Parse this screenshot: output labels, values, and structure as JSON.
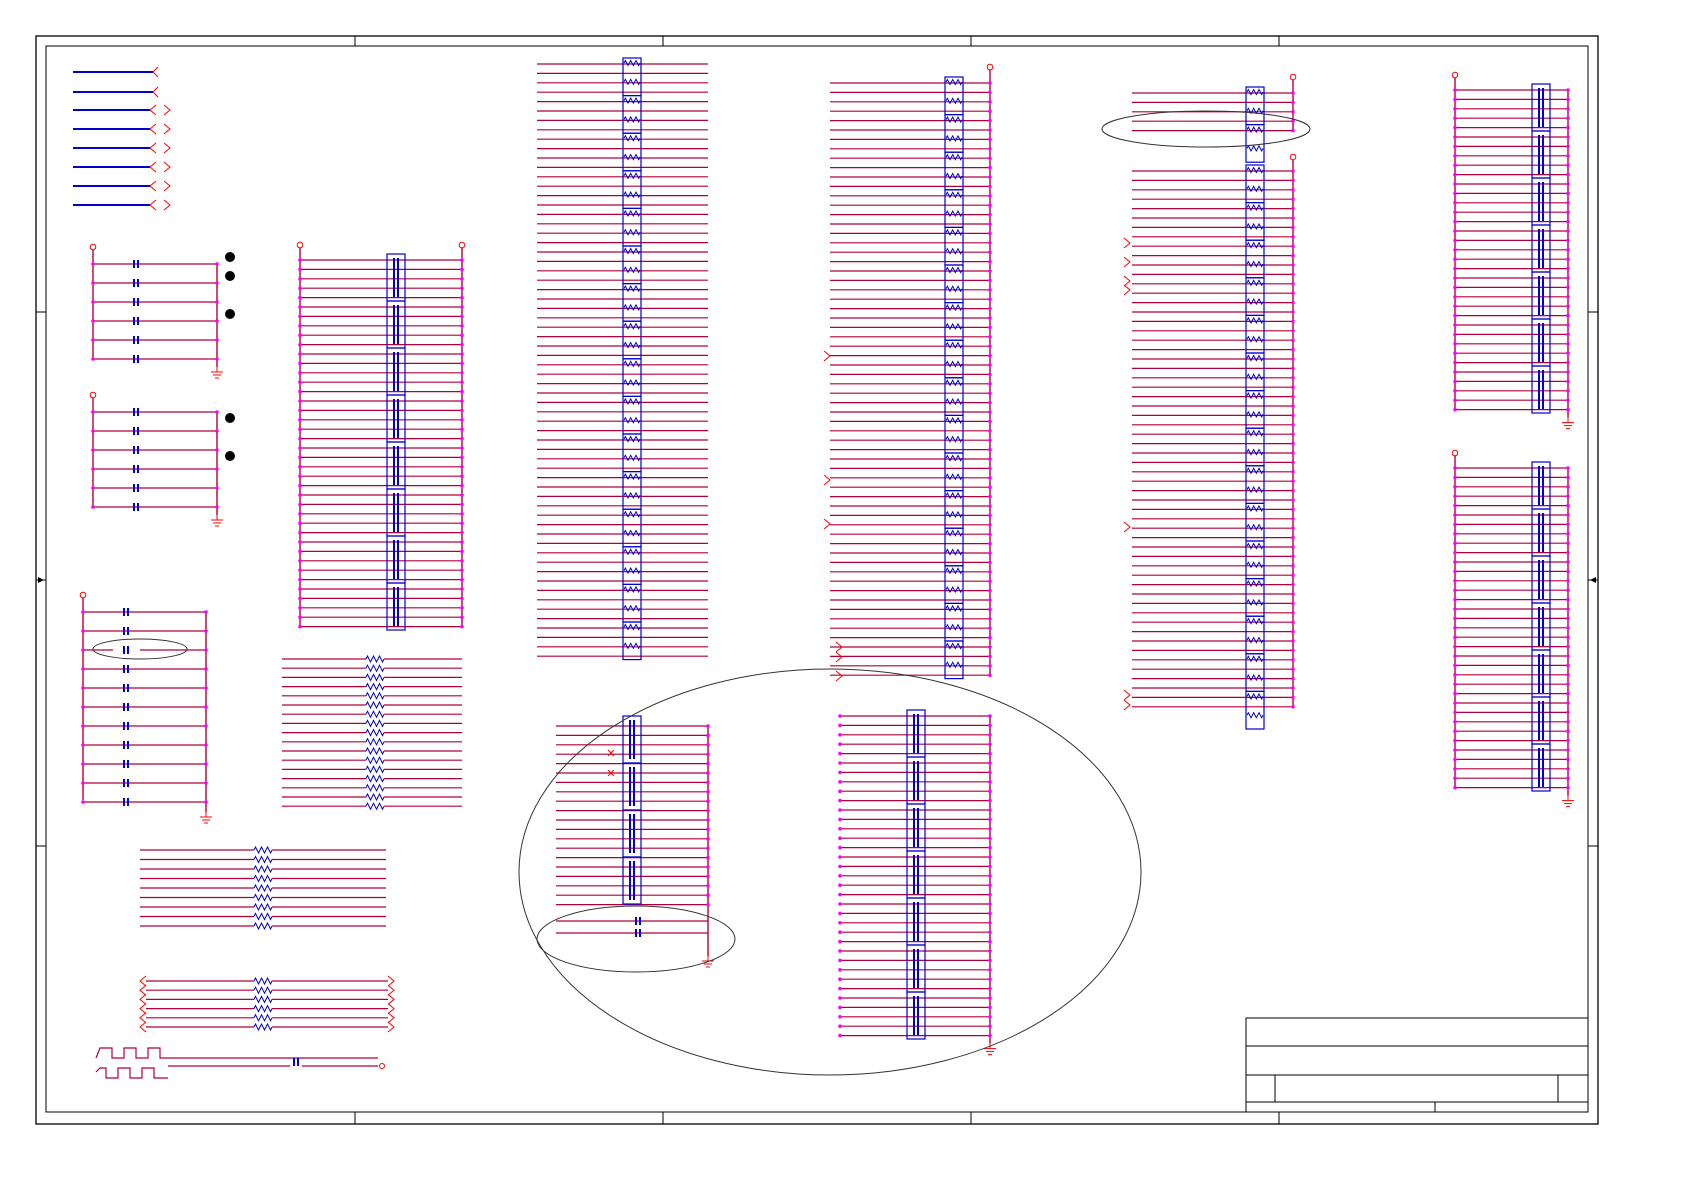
{
  "page": {
    "title": "",
    "description": ""
  },
  "colors": {
    "wire": "#b0003a",
    "net_label": "#0000d0",
    "component": "#0000d0",
    "pin_dot": "#ff00ff",
    "power_symbol": "#ff0000",
    "frame": "#000000"
  },
  "title_block": {
    "title": "",
    "document_number": "",
    "revision": "",
    "size": "",
    "date": "",
    "sheet": ""
  }
}
